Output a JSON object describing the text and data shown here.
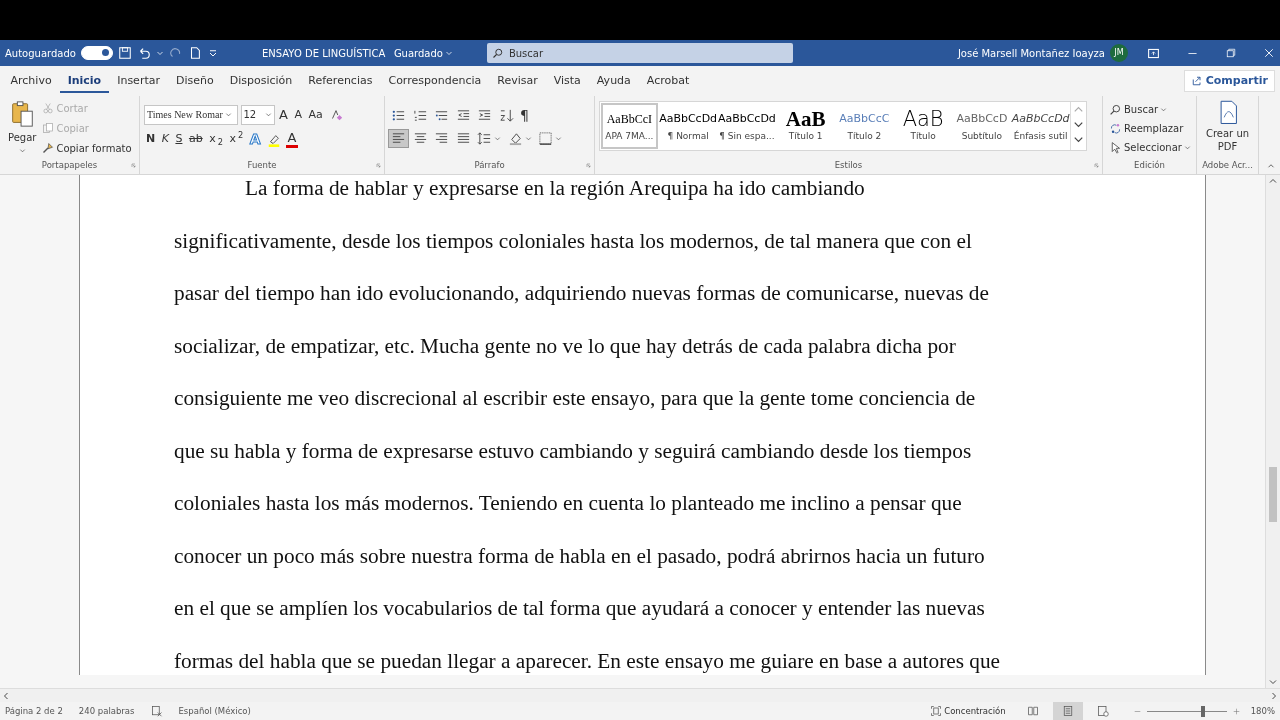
{
  "title_bar": {
    "autosave_label": "Autoguardado",
    "autosave_on": true,
    "document_title": "ENSAYO DE LINGUÍSTICA",
    "save_status": "Guardado",
    "search_placeholder": "Buscar",
    "user_name": "José Marsell Montañez Ioayza",
    "user_initials": "JM"
  },
  "ribbon_tabs": [
    {
      "label": "Archivo",
      "selected": false
    },
    {
      "label": "Inicio",
      "selected": true
    },
    {
      "label": "Insertar",
      "selected": false
    },
    {
      "label": "Diseño",
      "selected": false
    },
    {
      "label": "Disposición",
      "selected": false
    },
    {
      "label": "Referencias",
      "selected": false
    },
    {
      "label": "Correspondencia",
      "selected": false
    },
    {
      "label": "Revisar",
      "selected": false
    },
    {
      "label": "Vista",
      "selected": false
    },
    {
      "label": "Ayuda",
      "selected": false
    },
    {
      "label": "Acrobat",
      "selected": false
    }
  ],
  "share_label": "Compartir",
  "clipboard": {
    "paste_label": "Pegar",
    "items": [
      {
        "kind": "cut",
        "label": "Cortar",
        "disabled": true
      },
      {
        "kind": "copy",
        "label": "Copiar",
        "disabled": true
      },
      {
        "kind": "format",
        "label": "Copiar formato",
        "disabled": false
      }
    ],
    "group_label": "Portapapeles"
  },
  "font": {
    "font_name": "Times New Romar",
    "font_size": "12",
    "grow_label": "A",
    "shrink_label": "A",
    "case_label": "Aa",
    "bold_label": "N",
    "italic_label": "K",
    "underline_label": "S",
    "strike_label": "ab",
    "subscript_label": "x",
    "subscript_mark": "2",
    "superscript_label": "x",
    "superscript_mark": "2",
    "effects_label": "A",
    "color_label": "A",
    "group_label": "Fuente"
  },
  "paragraph": {
    "alignments": [
      {
        "kind": "left",
        "selected": true
      },
      {
        "kind": "center",
        "selected": false
      },
      {
        "kind": "right",
        "selected": false
      },
      {
        "kind": "justify",
        "selected": false
      }
    ],
    "pilcrow_label": "¶",
    "group_label": "Párrafo"
  },
  "styles": {
    "items": [
      {
        "kind": "apa",
        "preview": "AaBbCcI",
        "name": "APA 7MA...",
        "selected": true
      },
      {
        "kind": "normal",
        "preview": "AaBbCcDd",
        "name": "¶ Normal",
        "selected": false
      },
      {
        "kind": "nospacing",
        "preview": "AaBbCcDd",
        "name": "¶ Sin espa...",
        "selected": false
      },
      {
        "kind": "heading1",
        "preview": "AaB",
        "name": "Título 1",
        "selected": false
      },
      {
        "kind": "heading2",
        "preview": "AaBbCcC",
        "name": "Título 2",
        "selected": false
      },
      {
        "kind": "title",
        "preview": "AaB",
        "name": "Título",
        "selected": false
      },
      {
        "kind": "subtitle",
        "preview": "AaBbCcD",
        "name": "Subtítulo",
        "selected": false
      },
      {
        "kind": "emphasis",
        "preview": "AaBbCcDd",
        "name": "Énfasis sutil",
        "selected": false
      }
    ],
    "group_label": "Estilos"
  },
  "editing": {
    "items": [
      {
        "kind": "find",
        "label": "Buscar",
        "dropdown": true
      },
      {
        "kind": "replace",
        "label": "Reemplazar",
        "dropdown": false
      },
      {
        "kind": "select",
        "label": "Seleccionar",
        "dropdown": true
      }
    ],
    "group_label": "Edición"
  },
  "adobe": {
    "button_label": "Crear un PDF",
    "group_label": "Adobe Acr..."
  },
  "document": {
    "first_line_indent": true,
    "lines": [
      "La forma de hablar y expresarse en la región Arequipa ha ido cambiando",
      "significativamente, desde los tiempos coloniales hasta los modernos, de tal manera que con el",
      "pasar del tiempo han ido evolucionando, adquiriendo nuevas formas de comunicarse, nuevas de",
      "socializar, de empatizar, etc. Mucha gente no ve lo que hay detrás de cada palabra dicha por",
      "consiguiente me veo discrecional al escribir este ensayo, para que la gente tome conciencia de",
      "que su habla y forma de expresarse estuvo cambiando y seguirá cambiando desde los tiempos",
      "coloniales hasta los más modernos. Teniendo en cuenta lo planteado me inclino a pensar que",
      "conocer un poco más sobre nuestra forma de habla en el pasado, podrá abrirnos hacia un futuro",
      "en el que se amplíen los vocabularios de tal forma que ayudará a conocer y entender las nuevas",
      "formas del habla que se puedan llegar a aparecer. En este ensayo me guiare en base a autores que"
    ]
  },
  "status_bar": {
    "page": "Página 2 de 2",
    "words": "240 palabras",
    "language": "Español (México)",
    "focus_label": "Concentración",
    "views": [
      {
        "kind": "read",
        "selected": false
      },
      {
        "kind": "print",
        "selected": true
      },
      {
        "kind": "web",
        "selected": false
      }
    ],
    "zoom": "180%",
    "zoom_slider": {
      "level": 0.7
    }
  }
}
